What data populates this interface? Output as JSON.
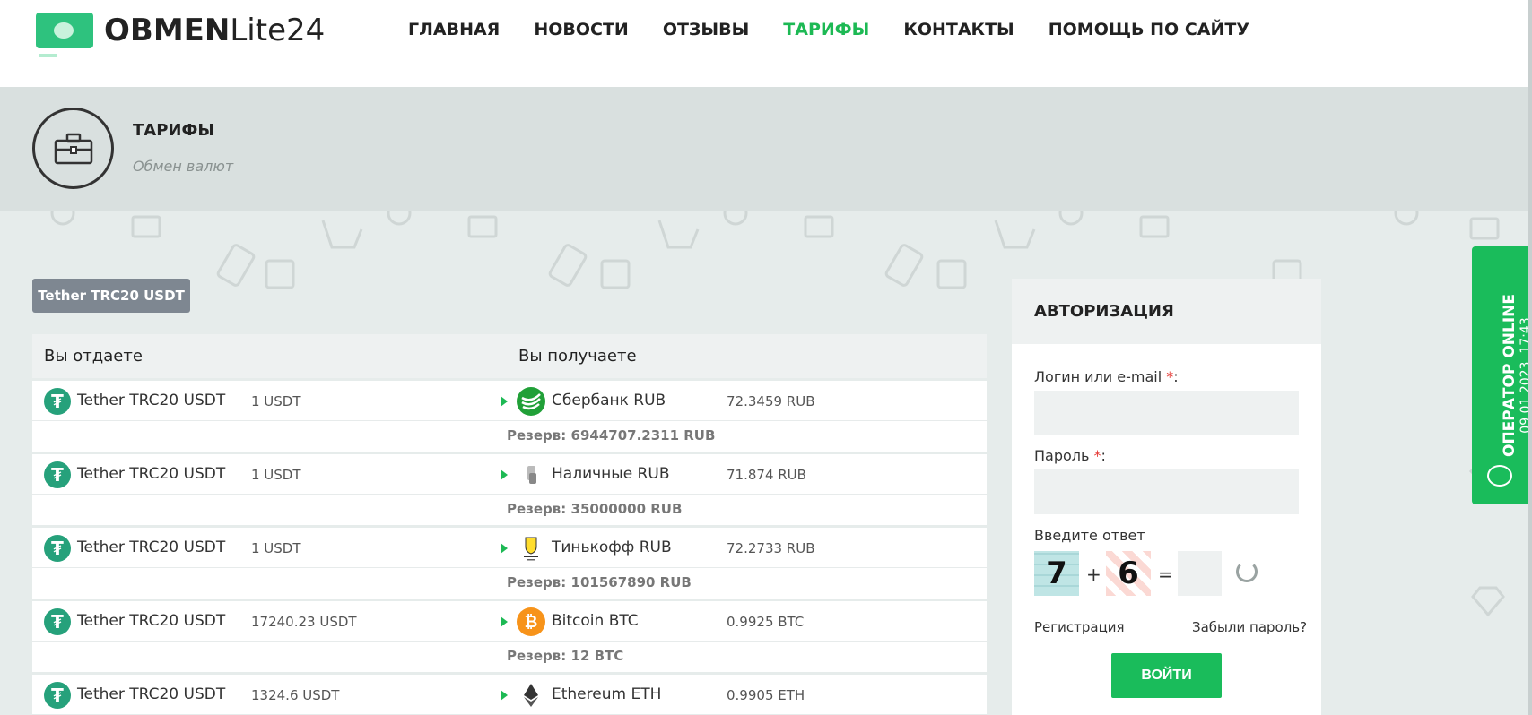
{
  "logo": {
    "bold": "OBMEN",
    "light": "Lite24"
  },
  "nav": [
    {
      "label": "ГЛАВНАЯ",
      "active": false
    },
    {
      "label": "НОВОСТИ",
      "active": false
    },
    {
      "label": "ОТЗЫВЫ",
      "active": false
    },
    {
      "label": "ТАРИФЫ",
      "active": true
    },
    {
      "label": "КОНТАКТЫ",
      "active": false
    },
    {
      "label": "ПОМОЩЬ ПО САЙТУ",
      "active": false
    }
  ],
  "page": {
    "title": "ТАРИФЫ",
    "subtitle": "Обмен валют",
    "icon": "briefcase-icon"
  },
  "filter": {
    "label": "Tether TRC20 USDT"
  },
  "table": {
    "col_give": "Вы отдаете",
    "col_receive": "Вы получаете",
    "reserve_label": "Резерв:",
    "rows": [
      {
        "from": "Tether TRC20 USDT",
        "from_amount": "1 USDT",
        "to": "Сбербанк RUB",
        "to_amount": "72.3459 RUB",
        "reserve": "6944707.2311 RUB",
        "to_icon": "sberbank-icon"
      },
      {
        "from": "Tether TRC20 USDT",
        "from_amount": "1 USDT",
        "to": "Наличные RUB",
        "to_amount": "71.874 RUB",
        "reserve": "35000000 RUB",
        "to_icon": "cash-icon"
      },
      {
        "from": "Tether TRC20 USDT",
        "from_amount": "1 USDT",
        "to": "Тинькофф RUB",
        "to_amount": "72.2733 RUB",
        "reserve": "101567890 RUB",
        "to_icon": "tinkoff-icon"
      },
      {
        "from": "Tether TRC20 USDT",
        "from_amount": "17240.23 USDT",
        "to": "Bitcoin BTC",
        "to_amount": "0.9925 BTC",
        "reserve": "12 BTC",
        "to_icon": "bitcoin-icon"
      },
      {
        "from": "Tether TRC20 USDT",
        "from_amount": "1324.6 USDT",
        "to": "Ethereum ETH",
        "to_amount": "0.9905 ETH",
        "reserve": "",
        "to_icon": "ethereum-icon"
      }
    ]
  },
  "auth": {
    "title": "АВТОРИЗАЦИЯ",
    "login_label": "Логин или e-mail",
    "password_label": "Пароль",
    "required_mark": "*",
    "colon": ":",
    "captcha_label": "Введите ответ",
    "captcha_a": "7",
    "captcha_op": "+",
    "captcha_b": "6",
    "captcha_eq": "=",
    "register": "Регистрация",
    "forgot": "Забыли пароль?",
    "submit": "ВОЙТИ"
  },
  "operator": {
    "label": "ОПЕРАТОР ONLINE",
    "datetime": "09.01.2023, 17:43"
  },
  "colors": {
    "accent": "#1db954",
    "button": "#1abc5b",
    "tether": "#26a17b",
    "bitcoin": "#f7931a",
    "sber": "#21a038"
  }
}
